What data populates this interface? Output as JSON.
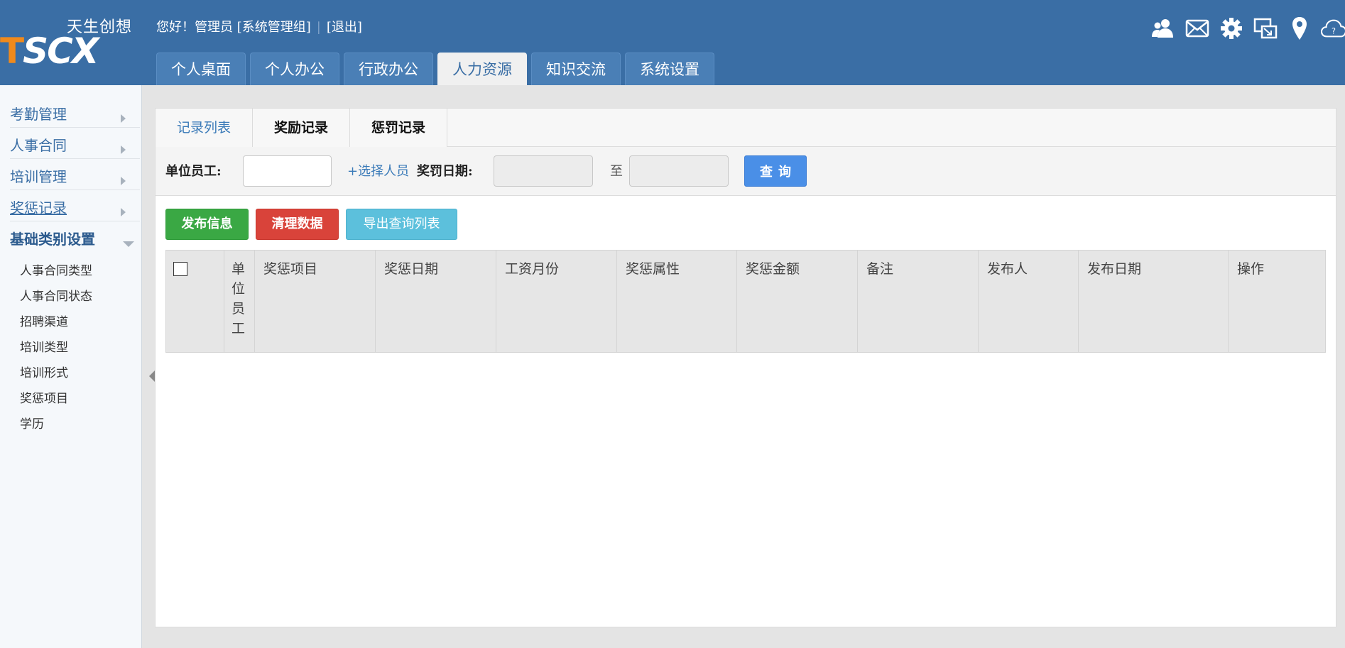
{
  "logo": {
    "letter_t": "T",
    "letters_rest": "SCX",
    "chinese": "天生创想"
  },
  "user_bar": {
    "greeting": "您好！管理员 [系统管理组]",
    "separator": "|",
    "logout": "[退出]"
  },
  "top_icons": [
    "users-icon",
    "mail-icon",
    "gear-icon",
    "screen-share-icon",
    "location-pin-icon",
    "cloud-help-icon"
  ],
  "main_tabs": [
    {
      "label": "个人桌面"
    },
    {
      "label": "个人办公"
    },
    {
      "label": "行政办公"
    },
    {
      "label": "人力资源",
      "active": true
    },
    {
      "label": "知识交流"
    },
    {
      "label": "系统设置"
    }
  ],
  "sidebar": {
    "items": [
      {
        "label": "考勤管理"
      },
      {
        "label": "人事合同"
      },
      {
        "label": "培训管理"
      },
      {
        "label": "奖惩记录"
      },
      {
        "label": "基础类别设置"
      }
    ],
    "sub_items": [
      "人事合同类型",
      "人事合同状态",
      "招聘渠道",
      "培训类型",
      "培训形式",
      "奖惩项目",
      "学历"
    ]
  },
  "sub_tabs": [
    {
      "label": "记录列表",
      "active": true
    },
    {
      "label": "奖励记录"
    },
    {
      "label": "惩罚记录"
    }
  ],
  "filter": {
    "employee_label": "单位员工:",
    "employee_value": "",
    "pick_person": "+选择人员",
    "date_label": "奖罚日期:",
    "date_from": "",
    "to_label": "至",
    "date_to": "",
    "search_button": "查询"
  },
  "actions": {
    "publish": "发布信息",
    "clear": "清理数据",
    "export": "导出查询列表"
  },
  "table": {
    "columns": [
      "单位员工",
      "奖惩项目",
      "奖惩日期",
      "工资月份",
      "奖惩属性",
      "奖惩金额",
      "备注",
      "发布人",
      "发布日期",
      "操作"
    ],
    "rows": []
  },
  "colors": {
    "header_bg": "#3a6ea5",
    "logo_orange": "#f08a1c",
    "accent_blue": "#4a8fe7",
    "publish_green": "#3aa844",
    "clear_red": "#d9433a",
    "export_cyan": "#5cc0dc"
  }
}
